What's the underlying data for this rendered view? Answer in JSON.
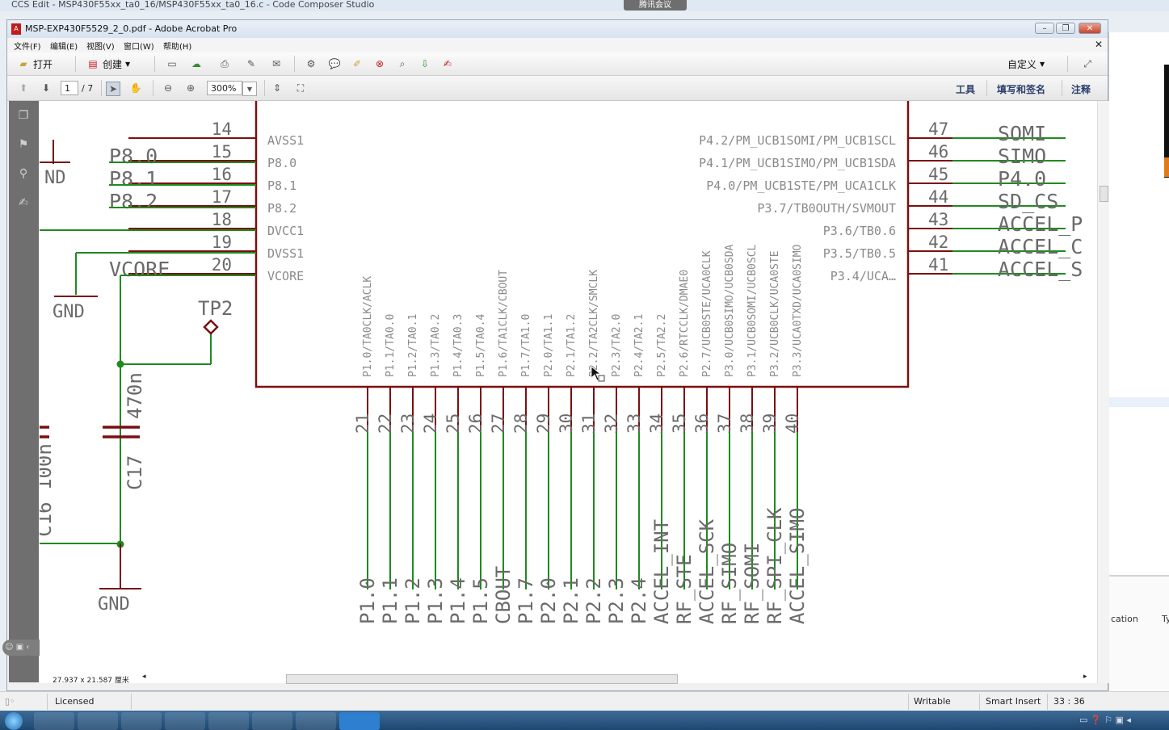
{
  "ccs": {
    "title": "CCS Edit - MSP430F55xx_ta0_16/MSP430F55xx_ta0_16.c - Code Composer Studio",
    "meeting_badge": "腾讯会议",
    "table_col_location": "cation",
    "table_col_type": "Ty",
    "status": {
      "licensed": "Licensed",
      "writable": "Writable",
      "insert_mode": "Smart Insert",
      "position": "33 : 36"
    }
  },
  "acrobat": {
    "title": "MSP-EXP430F5529_2_0.pdf - Adobe Acrobat Pro",
    "menu": [
      "文件(F)",
      "编辑(E)",
      "视图(V)",
      "窗口(W)",
      "帮助(H)"
    ],
    "toolbar": {
      "open": "打开",
      "create": "创建",
      "customize": "自定义"
    },
    "nav": {
      "page": "1",
      "page_total": "/ 7",
      "zoom": "300%"
    },
    "right_links": {
      "tools": "工具",
      "fill_sign": "填写和签名",
      "comment": "注释"
    },
    "page_size": "27.937 x 21.587 厘米"
  },
  "schematic": {
    "left_pins": [
      {
        "num": "14",
        "name": "AVSS1",
        "net": ""
      },
      {
        "num": "15",
        "name": "P8.0",
        "net": "P8.0"
      },
      {
        "num": "16",
        "name": "P8.1",
        "net": "P8.1"
      },
      {
        "num": "17",
        "name": "P8.2",
        "net": "P8.2"
      },
      {
        "num": "18",
        "name": "DVCC1",
        "net": ""
      },
      {
        "num": "19",
        "name": "DVSS1",
        "net": ""
      },
      {
        "num": "20",
        "name": "VCORE",
        "net": "VCORE"
      }
    ],
    "right_pins": [
      {
        "num": "47",
        "name": "P4.2/PM_UCB1SOMI/PM_UCB1SCL",
        "net": "SOMI"
      },
      {
        "num": "46",
        "name": "P4.1/PM_UCB1SIMO/PM_UCB1SDA",
        "net": "SIMO"
      },
      {
        "num": "45",
        "name": "P4.0/PM_UCB1STE/PM_UCA1CLK",
        "net": "P4.0"
      },
      {
        "num": "44",
        "name": "P3.7/TB0OUTH/SVMOUT",
        "net": "SD_CS"
      },
      {
        "num": "43",
        "name": "P3.6/TB0.6",
        "net": "ACCEL_P"
      },
      {
        "num": "42",
        "name": "P3.5/TB0.5",
        "net": "ACCEL_C"
      },
      {
        "num": "41",
        "name": "P3.4/UCA…",
        "net": "ACCEL_S"
      }
    ],
    "bottom_pins": [
      {
        "num": "21",
        "name": "P1.0/TA0CLK/ACLK",
        "net": "P1.0"
      },
      {
        "num": "22",
        "name": "P1.1/TA0.0",
        "net": "P1.1"
      },
      {
        "num": "23",
        "name": "P1.2/TA0.1",
        "net": "P1.2"
      },
      {
        "num": "24",
        "name": "P1.3/TA0.2",
        "net": "P1.3"
      },
      {
        "num": "25",
        "name": "P1.4/TA0.3",
        "net": "P1.4"
      },
      {
        "num": "26",
        "name": "P1.5/TA0.4",
        "net": "P1.5"
      },
      {
        "num": "27",
        "name": "P1.6/TA1CLK/CBOUT",
        "net": "CBOUT"
      },
      {
        "num": "28",
        "name": "P1.7/TA1.0",
        "net": "P1.7"
      },
      {
        "num": "29",
        "name": "P2.0/TA1.1",
        "net": "P2.0"
      },
      {
        "num": "30",
        "name": "P2.1/TA1.2",
        "net": "P2.1"
      },
      {
        "num": "31",
        "name": "P2.2/TA2CLK/SMCLK",
        "net": "P2.2"
      },
      {
        "num": "32",
        "name": "P2.3/TA2.0",
        "net": "P2.3"
      },
      {
        "num": "33",
        "name": "P2.4/TA2.1",
        "net": "P2.4"
      },
      {
        "num": "34",
        "name": "P2.5/TA2.2",
        "net": "ACCEL_INT"
      },
      {
        "num": "35",
        "name": "P2.6/RTCCLK/DMAE0",
        "net": "RF_STE"
      },
      {
        "num": "36",
        "name": "P2.7/UCB0STE/UCA0CLK",
        "net": "ACCEL_SCK"
      },
      {
        "num": "37",
        "name": "P3.0/UCB0SIMO/UCB0SDA",
        "net": "RF_SIMO"
      },
      {
        "num": "38",
        "name": "P3.1/UCB0SOMI/UCB0SCL",
        "net": "RF_SOMI"
      },
      {
        "num": "39",
        "name": "P3.2/UCB0CLK/UCA0STE",
        "net": "RF_SPI_CLK"
      },
      {
        "num": "40",
        "name": "P3.3/UCA0TXD/UCA0SIMO",
        "net": "ACCEL_SIMO"
      }
    ],
    "labels": {
      "gnd": "GND",
      "nd": "ND",
      "tp2": "TP2",
      "cap_value": "470n",
      "cap_name": "C17",
      "left_cap": "C16 100n"
    },
    "colors": {
      "body": "#7a1010",
      "wire": "#1f8a1f",
      "pin_text": "#8a8a8a",
      "net_text": "#6a6a6a"
    }
  }
}
